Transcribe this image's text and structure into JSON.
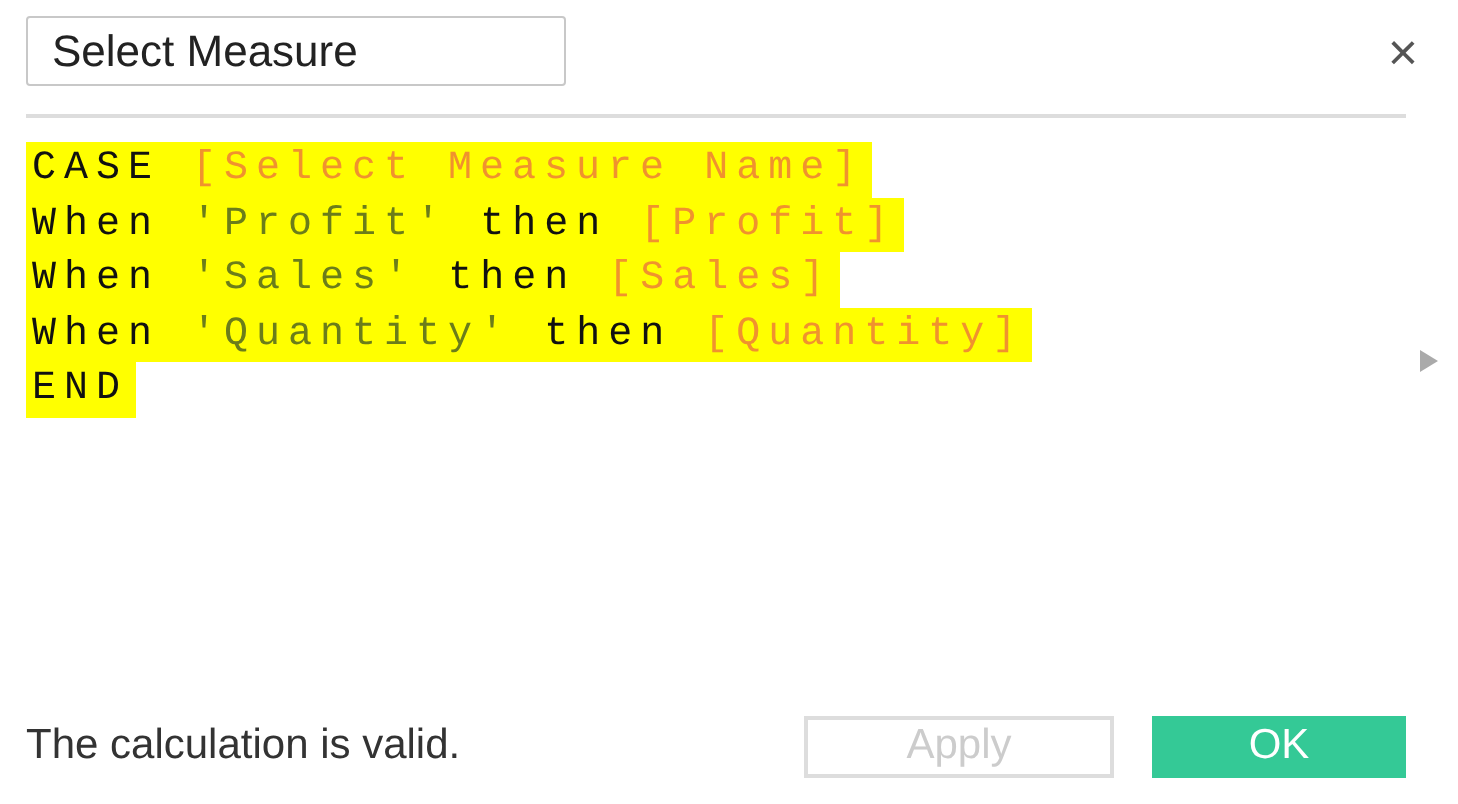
{
  "dialog": {
    "title_field": {
      "value": "Select Measure"
    },
    "close": "×"
  },
  "code_lines": [
    {
      "highlighted": true,
      "tokens": [
        {
          "kind": "keyword",
          "text": "CASE"
        },
        {
          "kind": "field",
          "text": "[Select Measure Name]"
        }
      ]
    },
    {
      "highlighted": true,
      "tokens": [
        {
          "kind": "keyword",
          "text": "When"
        },
        {
          "kind": "string",
          "text": "'Profit'"
        },
        {
          "kind": "keyword",
          "text": "then"
        },
        {
          "kind": "field",
          "text": "[Profit]"
        }
      ]
    },
    {
      "highlighted": true,
      "tokens": [
        {
          "kind": "keyword",
          "text": "When"
        },
        {
          "kind": "string",
          "text": "'Sales'"
        },
        {
          "kind": "keyword",
          "text": "then"
        },
        {
          "kind": "field",
          "text": "[Sales]"
        }
      ]
    },
    {
      "highlighted": true,
      "tokens": [
        {
          "kind": "keyword",
          "text": "When"
        },
        {
          "kind": "string",
          "text": "'Quantity'"
        },
        {
          "kind": "keyword",
          "text": "then"
        },
        {
          "kind": "field",
          "text": "[Quantity]"
        }
      ]
    },
    {
      "highlighted": true,
      "tokens": [
        {
          "kind": "keyword",
          "text": "END"
        }
      ]
    }
  ],
  "status": "The calculation is valid.",
  "buttons": [
    {
      "label": "Apply",
      "kind": "secondary",
      "disabled": true
    },
    {
      "label": "OK",
      "kind": "primary",
      "disabled": false
    }
  ]
}
